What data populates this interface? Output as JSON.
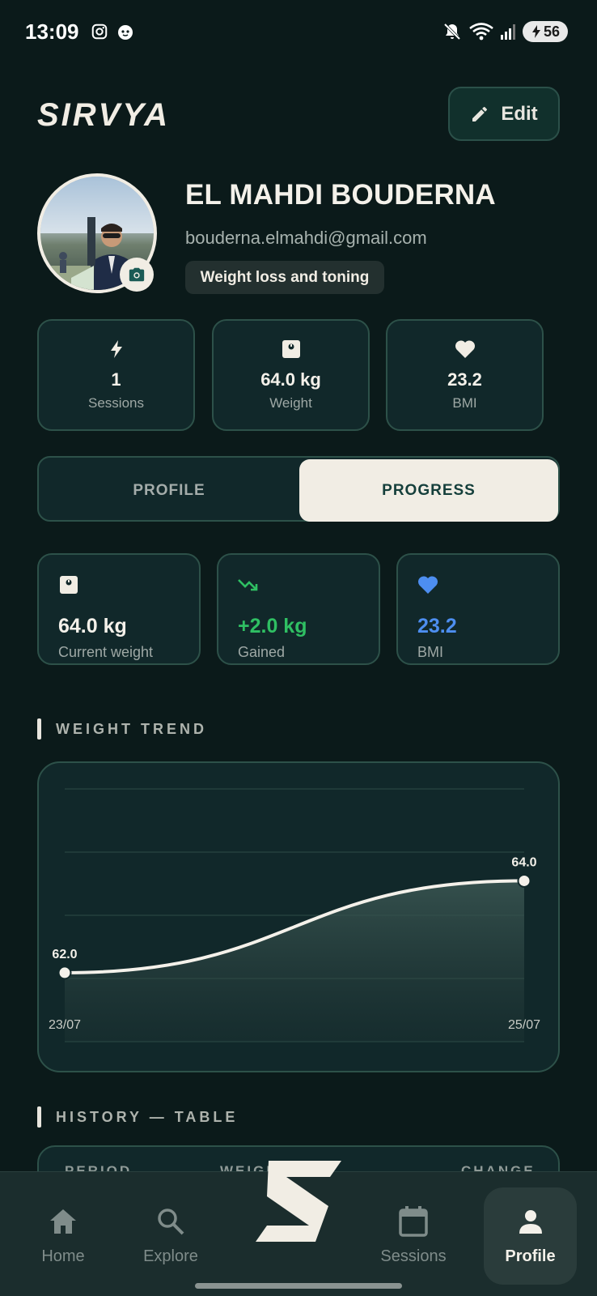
{
  "status_bar": {
    "time": "13:09",
    "battery_level": "56",
    "icons": [
      "instagram-icon",
      "notification-app-icon",
      "mute-icon",
      "wifi-icon",
      "signal-icon",
      "battery-charging-icon"
    ]
  },
  "header": {
    "brand": "SIRVYA",
    "edit_label": "Edit"
  },
  "profile": {
    "name": "EL MAHDI BOUDERNA",
    "email": "bouderna.elmahdi@gmail.com",
    "goal": "Weight loss and toning"
  },
  "stats": [
    {
      "icon": "bolt-icon",
      "value": "1",
      "label": "Sessions"
    },
    {
      "icon": "scale-icon",
      "value": "64.0 kg",
      "label": "Weight"
    },
    {
      "icon": "heart-icon",
      "value": "23.2",
      "label": "BMI"
    }
  ],
  "tabs": {
    "profile_label": "PROFILE",
    "progress_label": "PROGRESS",
    "active": "progress"
  },
  "metrics": [
    {
      "icon": "scale-icon",
      "value": "64.0 kg",
      "label": "Current weight",
      "color": "#f4f1ea"
    },
    {
      "icon": "trending-icon",
      "value": "+2.0 kg",
      "label": "Gained",
      "color": "#2fbf63"
    },
    {
      "icon": "heart-icon",
      "value": "23.2",
      "label": "BMI",
      "color": "#4d8ef0"
    }
  ],
  "weight_trend": {
    "title": "WEIGHT TREND"
  },
  "chart_data": {
    "type": "area",
    "x": [
      "23/07",
      "25/07"
    ],
    "series": [
      {
        "values": [
          62.0,
          64.0
        ]
      }
    ],
    "data_labels": [
      "62.0",
      "64.0"
    ],
    "x_tick_labels": [
      "23/07",
      "25/07"
    ],
    "ylim": [
      60.5,
      66
    ],
    "grid": true
  },
  "history": {
    "title": "HISTORY — TABLE",
    "columns": [
      "PERIOD",
      "WEIGHT",
      "CHANGE"
    ]
  },
  "nav": {
    "items": [
      {
        "label": "Home",
        "icon": "home-icon"
      },
      {
        "label": "Explore",
        "icon": "search-icon"
      },
      {
        "label": "Sessions",
        "icon": "calendar-icon"
      },
      {
        "label": "Profile",
        "icon": "person-icon"
      }
    ],
    "active": "Profile"
  }
}
